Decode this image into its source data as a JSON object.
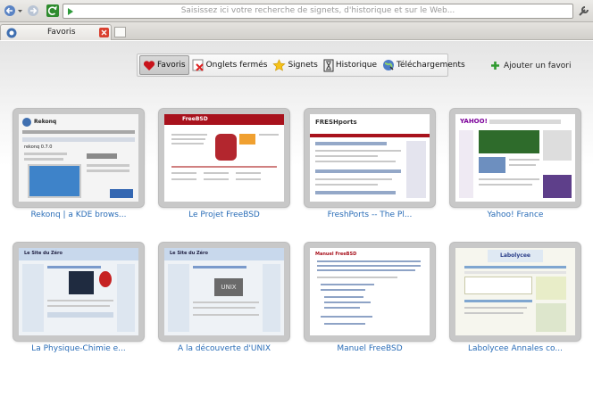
{
  "toolbar": {
    "search_placeholder": "Saisissez ici votre recherche de signets, d'historique et sur le Web..."
  },
  "tab": {
    "label": "Favoris"
  },
  "nav": {
    "favoris": "Favoris",
    "onglets": "Onglets fermés",
    "signets": "Signets",
    "historique": "Historique",
    "telechargements": "Téléchargements"
  },
  "add_favorite": "Ajouter un favori",
  "thumbnails": [
    {
      "caption": "Rekonq | a KDE brows...",
      "header": "Rekonq",
      "version": "rekonq 0.7.0"
    },
    {
      "caption": "Le Projet FreeBSD",
      "header": "FreeBSD"
    },
    {
      "caption": "FreshPorts -- The Pl...",
      "header": "FRESHports"
    },
    {
      "caption": "Yahoo! France",
      "header": "YAHOO!"
    },
    {
      "caption": "La Physique-Chimie e...",
      "header": "Le Site du Zéro"
    },
    {
      "caption": "A la découverte d'UNIX",
      "header": "Le Site du Zéro",
      "badge": "UNIX"
    },
    {
      "caption": "Manuel FreeBSD",
      "header": "Manuel FreeBSD"
    },
    {
      "caption": "Labolycee Annales co...",
      "header": "Labolycee"
    }
  ],
  "colors": {
    "accent_link": "#2a6db7",
    "freebsd_red": "#a8121d",
    "yahoo_purple": "#7b0099"
  }
}
